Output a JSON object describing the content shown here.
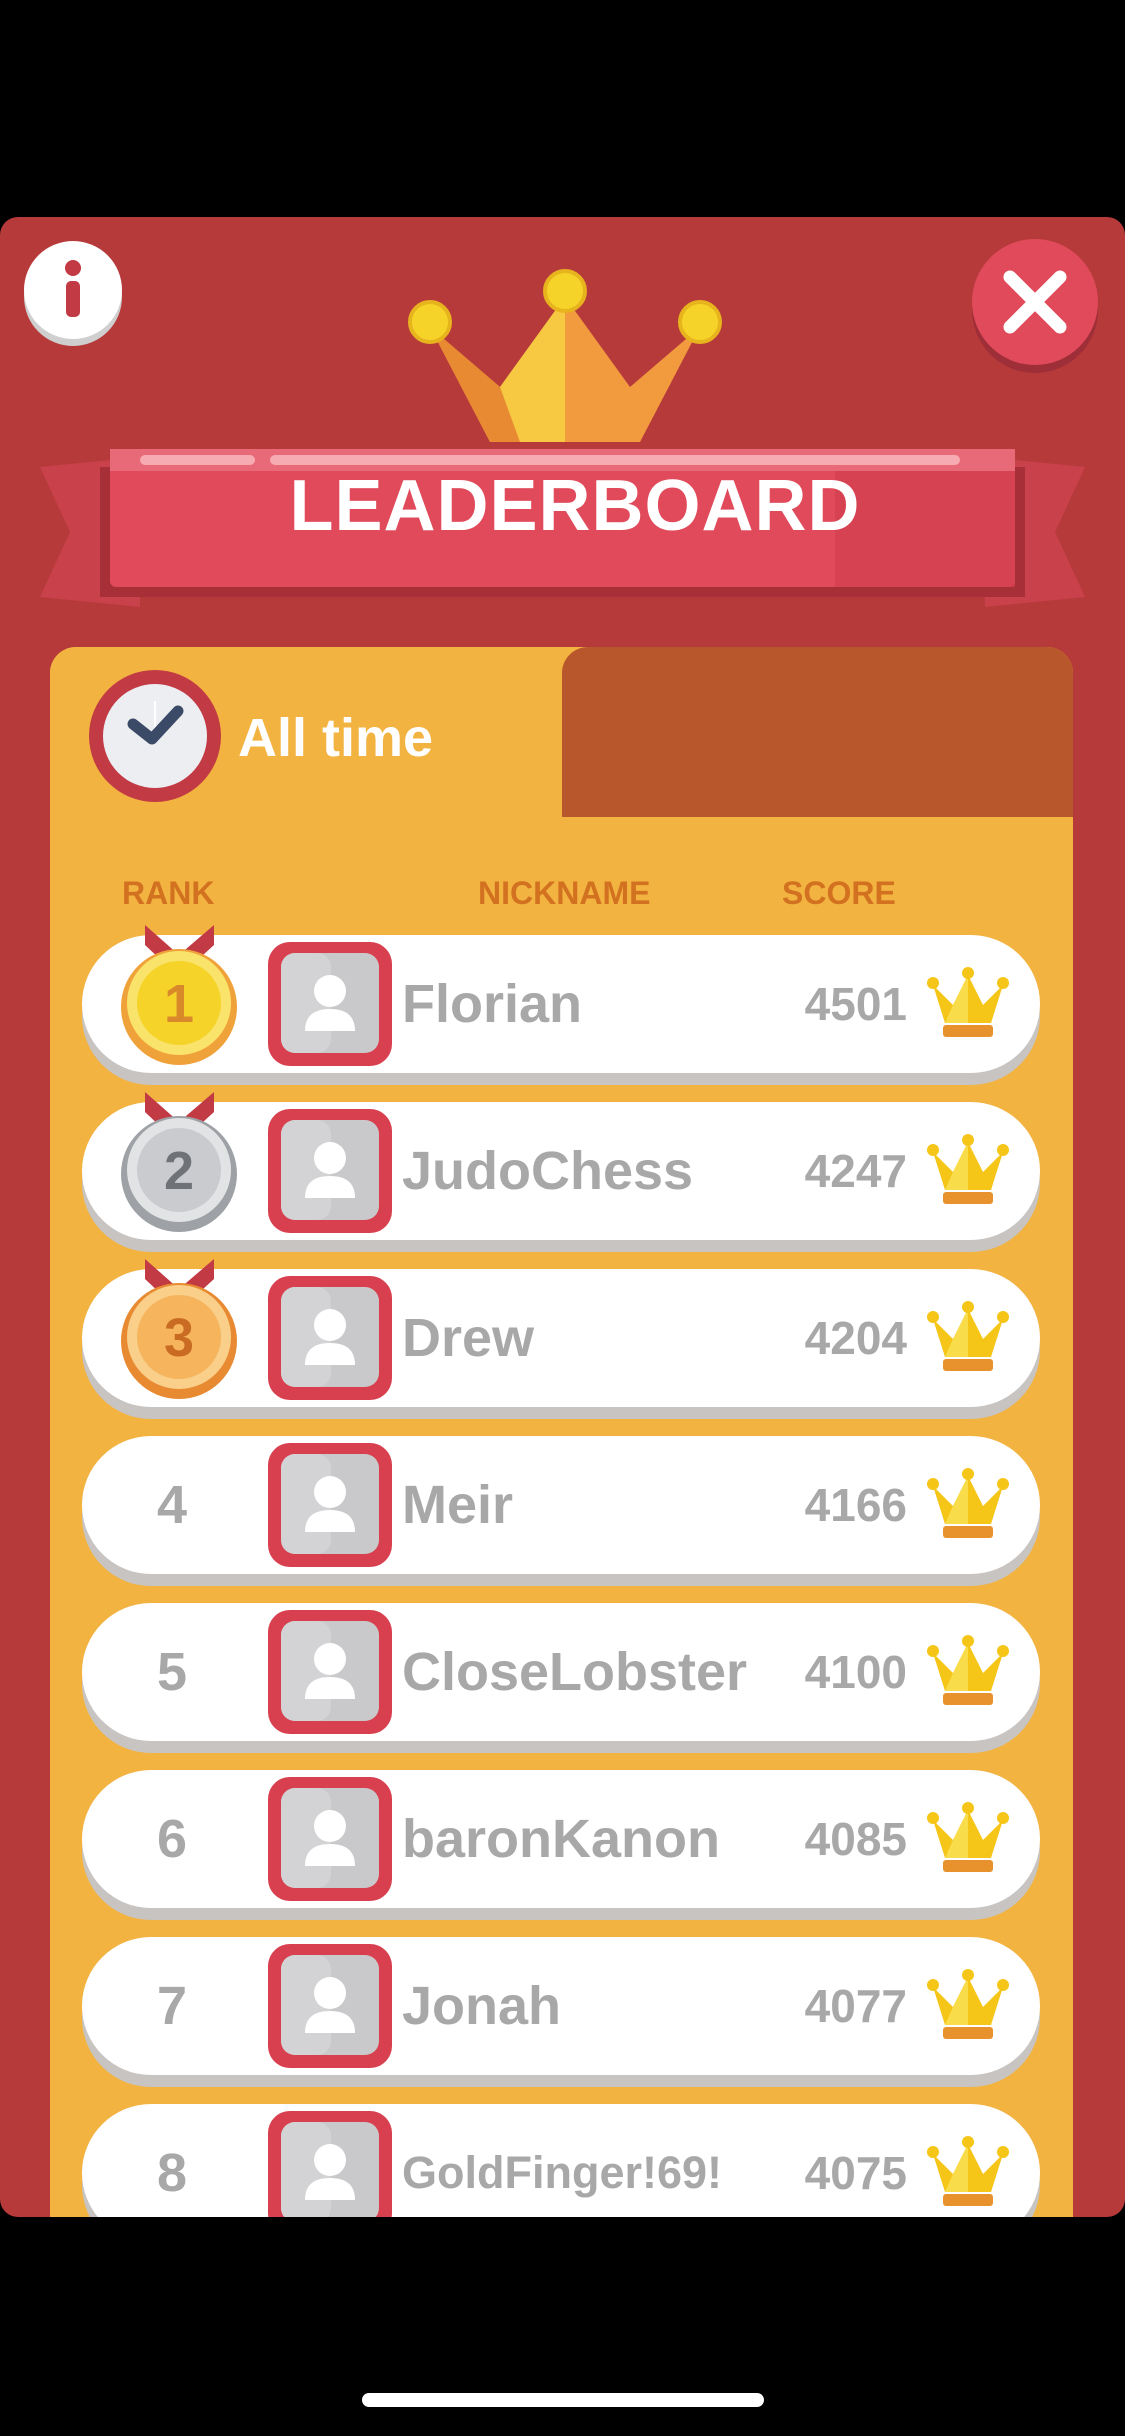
{
  "title": "LEADERBOARD",
  "tabs": [
    {
      "label": "All time",
      "active": true
    },
    {
      "label": "",
      "active": false
    }
  ],
  "columns": {
    "rank": "RANK",
    "nickname": "NICKNAME",
    "score": "SCORE"
  },
  "rows": [
    {
      "rank": "1",
      "nickname": "Florian",
      "score": "4501",
      "medal": "gold"
    },
    {
      "rank": "2",
      "nickname": "JudoChess",
      "score": "4247",
      "medal": "silver"
    },
    {
      "rank": "3",
      "nickname": "Drew",
      "score": "4204",
      "medal": "bronze"
    },
    {
      "rank": "4",
      "nickname": "Meir",
      "score": "4166",
      "medal": ""
    },
    {
      "rank": "5",
      "nickname": "CloseLobster",
      "score": "4100",
      "medal": ""
    },
    {
      "rank": "6",
      "nickname": "baronKanon",
      "score": "4085",
      "medal": ""
    },
    {
      "rank": "7",
      "nickname": "Jonah",
      "score": "4077",
      "medal": ""
    },
    {
      "rank": "8",
      "nickname": "GoldFinger!69!",
      "score": "4075",
      "medal": ""
    }
  ],
  "icons": {
    "info": "info-icon",
    "close": "close-icon",
    "tab": "clock-icon",
    "row_avatar": "user-avatar-icon",
    "row_trophy": "crown-icon"
  },
  "colors": {
    "panel": "#b73a3b",
    "board": "#f2b341",
    "ribbon": "#e04a5a",
    "gold": "#f5c518",
    "silver": "#b9bcc0",
    "bronze": "#f0a24a"
  }
}
